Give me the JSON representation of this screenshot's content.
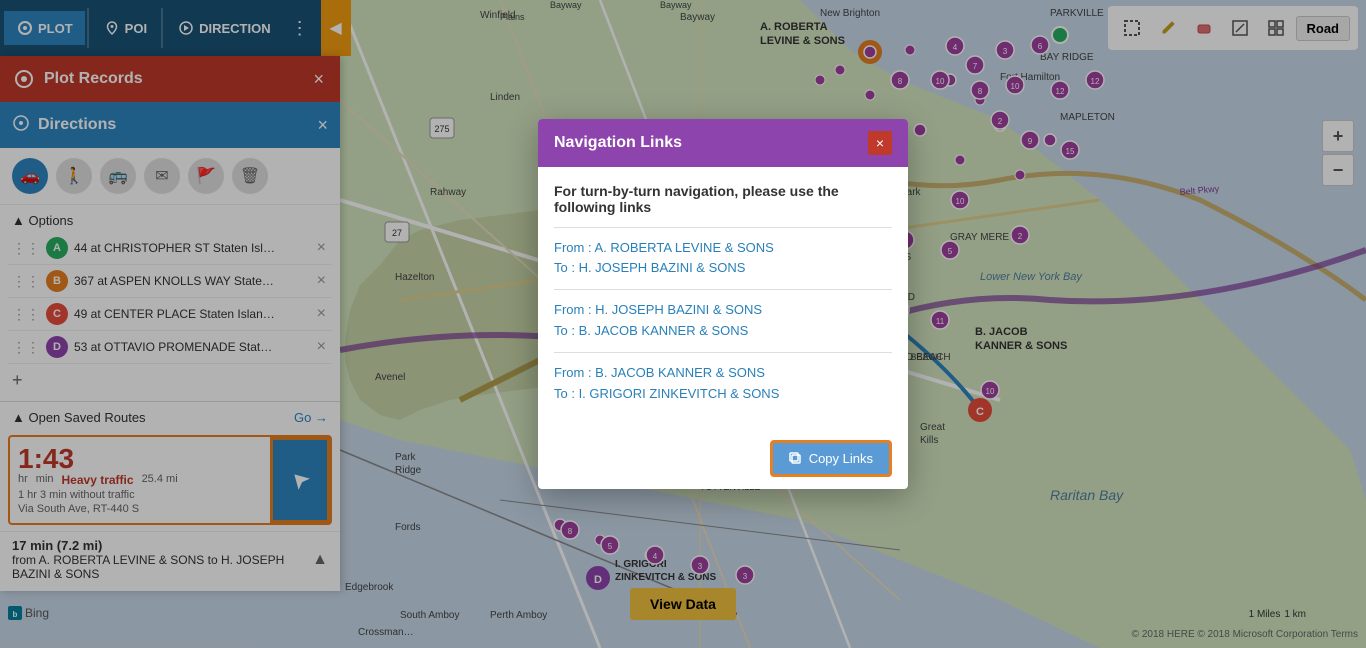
{
  "toolbar": {
    "plot_label": "PLOT",
    "poi_label": "POI",
    "direction_label": "DIRECTION",
    "road_label": "Road"
  },
  "tools": {
    "icons": [
      "⬚",
      "✏",
      "⌫",
      "⊡",
      "⊞"
    ]
  },
  "plot_records": {
    "title": "Plot Records",
    "close_label": "×"
  },
  "directions": {
    "title": "Directions",
    "close_label": "×"
  },
  "transport_icons": [
    "🚗",
    "🚶",
    "🚌",
    "✉",
    "🚩",
    "🗑"
  ],
  "options": {
    "toggle_label": "▲ Options"
  },
  "waypoints": [
    {
      "id": "a",
      "badge": "A",
      "text": "44 at CHRISTOPHER ST Staten Isl…",
      "badge_class": "badge-a"
    },
    {
      "id": "b",
      "badge": "B",
      "text": "367 at ASPEN KNOLLS WAY State…",
      "badge_class": "badge-b"
    },
    {
      "id": "c",
      "badge": "C",
      "text": "49 at CENTER PLACE Staten Islan…",
      "badge_class": "badge-c"
    },
    {
      "id": "d",
      "badge": "D",
      "text": "53 at OTTAVIO PROMENADE Stat…",
      "badge_class": "badge-d"
    }
  ],
  "saved_routes": {
    "toggle_label": "▲ Open Saved Routes",
    "go_label": "Go →"
  },
  "route_card": {
    "hours": "1:43",
    "hr_label": "hr",
    "min_label": "min",
    "traffic_label": "Heavy traffic",
    "distance_label": "25.4 mi",
    "detail": "1 hr 3 min without traffic",
    "via": "Via South Ave, RT-440 S"
  },
  "route_summary": {
    "distance": "17 min (7.2 mi)",
    "from_to": "from A. ROBERTA LEVINE & SONS to H. JOSEPH BAZINI & SONS"
  },
  "modal": {
    "title": "Navigation Links",
    "close_label": "×",
    "intro": "For turn-by-turn navigation, please use the following links",
    "links": [
      {
        "from": "From : A. ROBERTA LEVINE & SONS",
        "to": "To : H. JOSEPH BAZINI & SONS"
      },
      {
        "from": "From : H. JOSEPH BAZINI & SONS",
        "to": "To : B. JACOB KANNER & SONS"
      },
      {
        "from": "From : B. JACOB KANNER & SONS",
        "to": "To : I. GRIGORI ZINKEVITCH & SONS"
      }
    ],
    "copy_button": "Copy Links"
  },
  "map": {
    "labels": [
      {
        "text": "A. ROBERTA LEVINE & SONS",
        "top": "18",
        "left": "760"
      },
      {
        "text": "B. JACOB KANNER & SONS",
        "top": "340",
        "left": "975"
      },
      {
        "text": "I. GRIGORI ZINKEVITCH & SONS",
        "top": "565",
        "left": "615"
      }
    ]
  },
  "bottom": {
    "view_data": "View Data",
    "scale_miles": "1 Miles",
    "scale_km": "1 km",
    "bing": "Bing",
    "copyright": "© 2018 HERE © 2018 Microsoft Corporation  Terms"
  }
}
